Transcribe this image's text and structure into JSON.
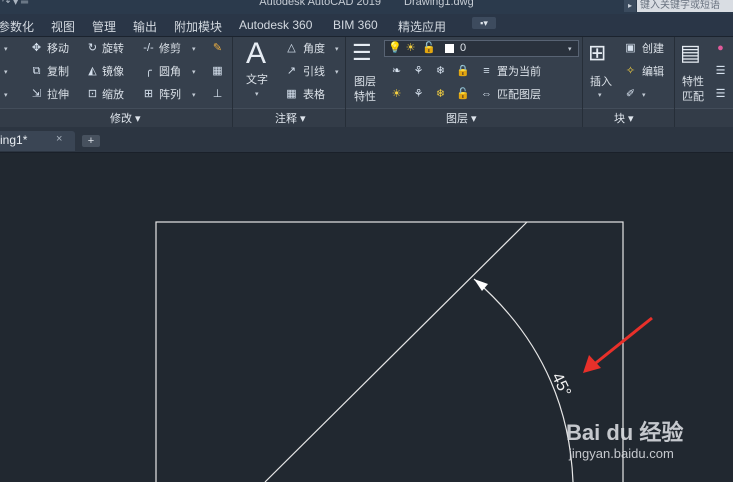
{
  "titlebar": {
    "app_title": "Autodesk AutoCAD 2019",
    "doc_title": "Drawing1.dwg",
    "search_placeholder": "键入关键字或短语"
  },
  "menu_tabs": [
    "参数化",
    "视图",
    "管理",
    "输出",
    "附加模块",
    "Autodesk 360",
    "BIM 360",
    "精选应用"
  ],
  "ribbon": {
    "modify": {
      "title": "修改",
      "items": [
        "移动",
        "旋转",
        "修剪",
        "复制",
        "镜像",
        "圆角",
        "拉伸",
        "缩放",
        "阵列"
      ]
    },
    "annotation": {
      "title": "注释",
      "text_label": "文字",
      "items": [
        "角度",
        "引线",
        "表格"
      ]
    },
    "layers": {
      "title": "图层",
      "properties_label_1": "图层",
      "properties_label_2": "特性",
      "current_layer": "0",
      "make_current": "置为当前",
      "match_layer": "匹配图层"
    },
    "block": {
      "title": "块",
      "insert": "插入",
      "create": "创建",
      "edit": "编辑"
    },
    "properties": {
      "match_1": "特性",
      "match_2": "匹配"
    }
  },
  "document_tab": {
    "label": "ing1*",
    "close": "×",
    "new_tab": "+"
  },
  "drawing": {
    "dimension_text": "45°"
  },
  "watermark": {
    "logo": "Bai du 经验",
    "url": "jingyan.baidu.com"
  },
  "colors": {
    "canvas": "#212830",
    "ribbon": "#36404d",
    "annotation_arrow": "#e8302a",
    "geometry": "#e6e6e6"
  }
}
